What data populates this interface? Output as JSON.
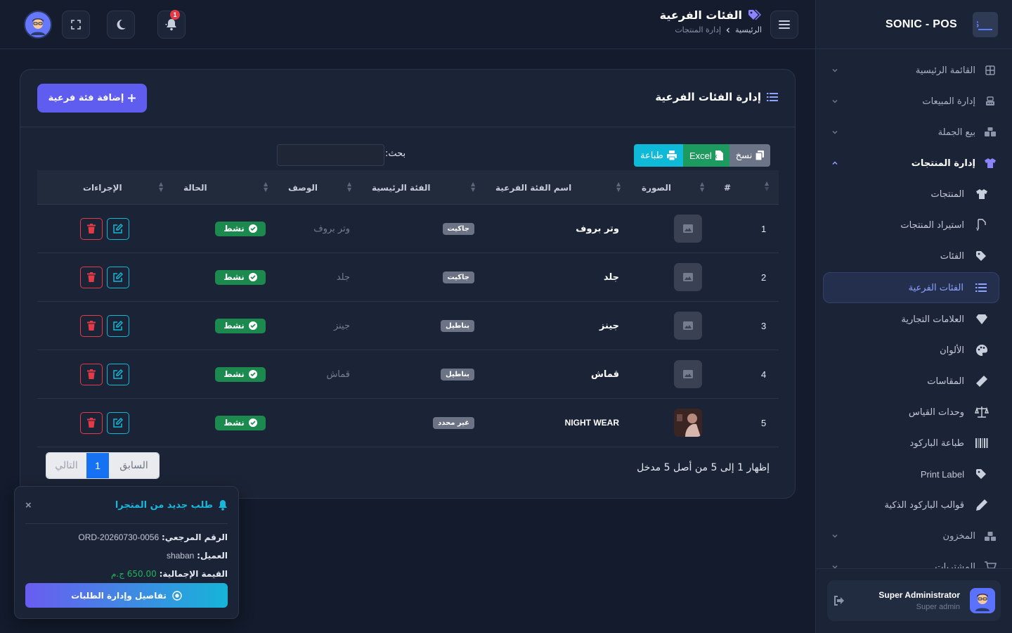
{
  "app": {
    "brand": "SONIC - POS"
  },
  "sidebar": {
    "items": [
      {
        "label": "القائمة الرئيسية",
        "icon": "grid-icon"
      },
      {
        "label": "إدارة المبيعات",
        "icon": "cash-register-icon"
      },
      {
        "label": "بيع الجملة",
        "icon": "boxes-icon"
      },
      {
        "label": "إدارة المنتجات",
        "icon": "shirt-icon"
      }
    ],
    "sub_items": [
      {
        "label": "المنتجات",
        "icon": "shirt-icon"
      },
      {
        "label": "استيراد المنتجات",
        "icon": "csv-file-icon"
      },
      {
        "label": "الفئات",
        "icon": "tags-icon"
      },
      {
        "label": "الفئات الفرعية",
        "icon": "list-icon"
      },
      {
        "label": "العلامات التجارية",
        "icon": "gem-icon"
      },
      {
        "label": "الألوان",
        "icon": "palette-icon"
      },
      {
        "label": "المقاسات",
        "icon": "ruler-icon"
      },
      {
        "label": "وحدات القياس",
        "icon": "scale-icon"
      },
      {
        "label": "طباعة الباركود",
        "icon": "barcode-icon"
      },
      {
        "label": "Print Label",
        "icon": "tags-icon"
      },
      {
        "label": "قوالب الباركود الذكية",
        "icon": "pen-icon"
      }
    ],
    "items_after": [
      {
        "label": "المخزون",
        "icon": "warehouse-icon"
      },
      {
        "label": "المشتريات",
        "icon": "cart-icon"
      }
    ],
    "user": {
      "name": "Super Administrator",
      "role": "Super admin"
    }
  },
  "header": {
    "title": "الفئات الفرعية",
    "breadcrumb": [
      "الرئيسية",
      "إدارة المنتجات"
    ],
    "notification_count": "1"
  },
  "card": {
    "title": "إدارة الفئات الفرعية",
    "add_button": "إضافة فئة فرعية",
    "tools": {
      "copy": "نسخ",
      "excel": "Excel",
      "print": "طباعة"
    },
    "search_label": "بحث:",
    "search_value": ""
  },
  "table": {
    "columns": [
      "#",
      "الصورة",
      "اسم الفئة الفرعية",
      "الفئة الرئيسية",
      "الوصف",
      "الحالة",
      "الإجراءات"
    ],
    "rows": [
      {
        "num": "1",
        "name": "وتر بروف",
        "parent": "جاكيت",
        "desc": "وتر بروف",
        "status": "نشط"
      },
      {
        "num": "2",
        "name": "جلد",
        "parent": "جاكيت",
        "desc": "جلد",
        "status": "نشط"
      },
      {
        "num": "3",
        "name": "جينز",
        "parent": "بناطيل",
        "desc": "جينز",
        "status": "نشط"
      },
      {
        "num": "4",
        "name": "قماش",
        "parent": "بناطيل",
        "desc": "قماش",
        "status": "نشط"
      },
      {
        "num": "5",
        "name": "NIGHT WEAR",
        "parent": "غير محدد",
        "desc": "",
        "status": "نشط"
      }
    ],
    "info": "إظهار 1 إلى 5 من أصل 5 مدخل",
    "pager": {
      "prev": "السابق",
      "current": "1",
      "next": "التالي"
    }
  },
  "toast": {
    "title": "طلب جديد من المتجرا",
    "ref_label": "الرقم المرجعي:",
    "ref_value": "ORD-20260730-0056",
    "customer_label": "العميل:",
    "customer_value": "shaban",
    "total_label": "القيمة الإجمالية:",
    "total_value": "650.00 ج.م",
    "button": "تفاصيل وإدارة الطلبات",
    "close": "×"
  },
  "colors": {
    "accent": "#5f5cf0",
    "success": "#1c8a4e",
    "danger": "#e23a46",
    "info": "#0fb9d8"
  }
}
